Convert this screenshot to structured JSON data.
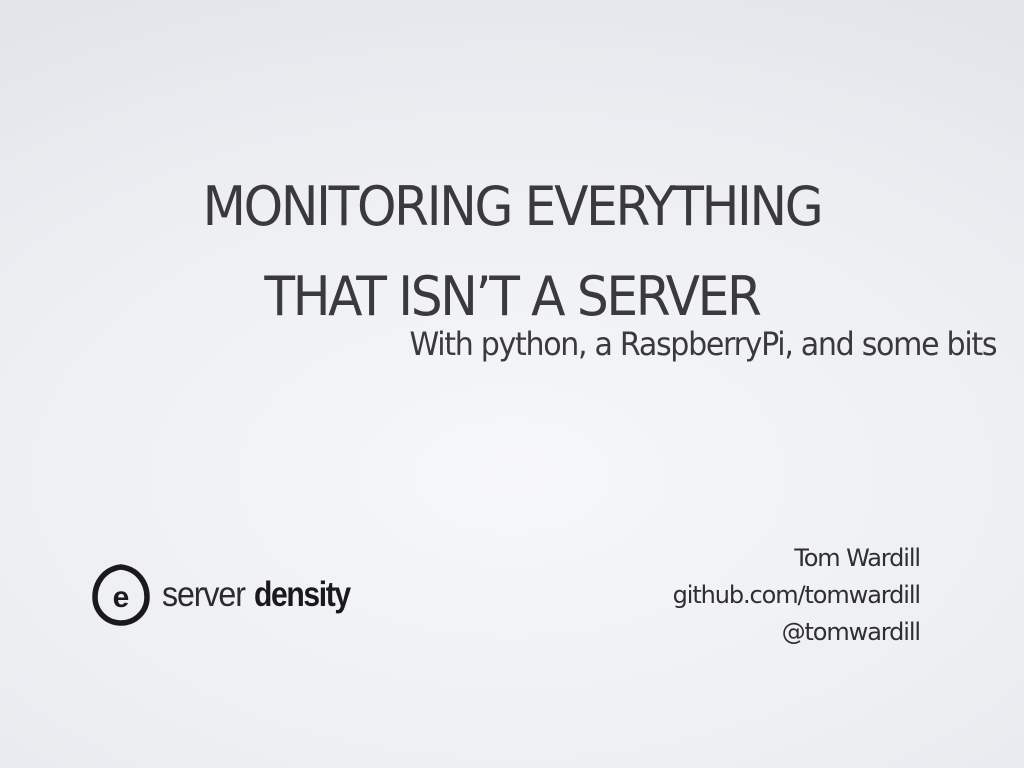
{
  "slide": {
    "title_lines": [
      "MONITORING EVERYTHING",
      "THAT ISN’T A SERVER"
    ],
    "subtitle": "With python, a RaspberryPi, and some bits"
  },
  "logo": {
    "icon": "server-density-e-icon",
    "icon_letter": "e",
    "text_light": "server",
    "text_bold": "density"
  },
  "author": {
    "name": "Tom Wardill",
    "github": "github.com/tomwardill",
    "twitter": "@tomwardill"
  },
  "colors": {
    "text": "#3a3a3a",
    "background": "#eceef2"
  }
}
